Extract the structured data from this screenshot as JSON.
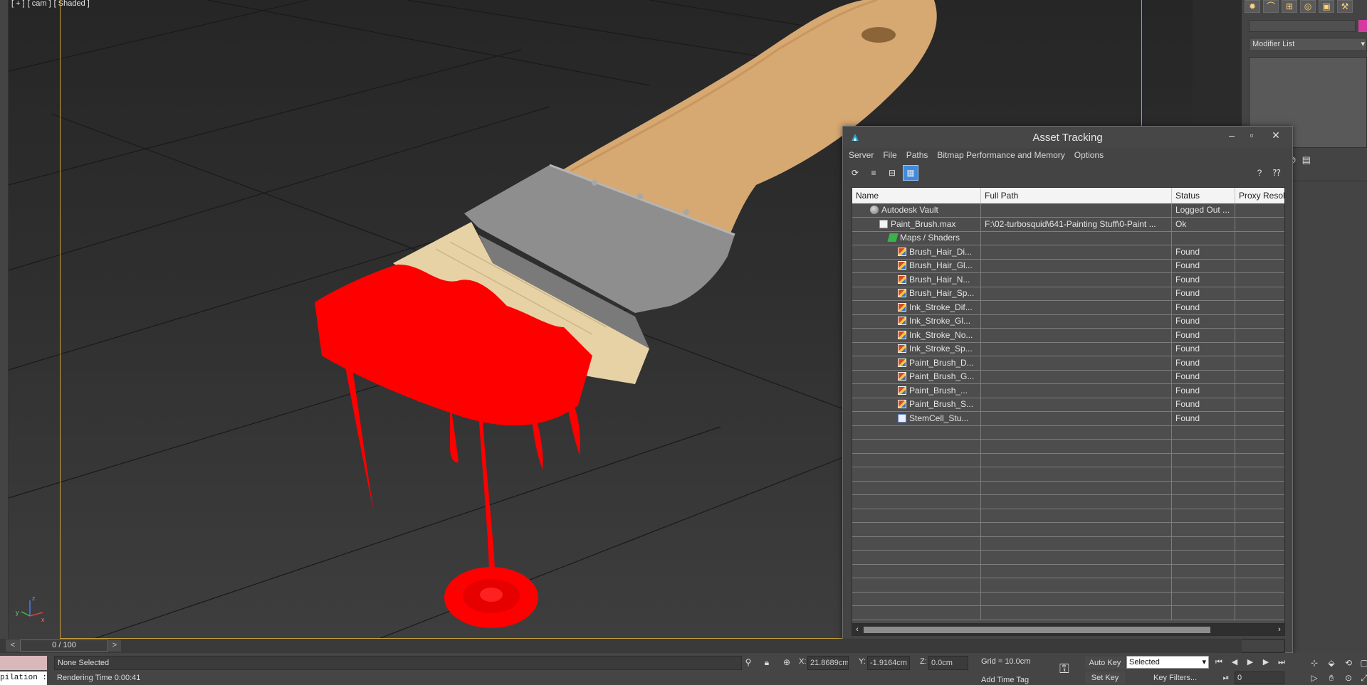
{
  "viewport": {
    "labels": [
      "[ + ]",
      "[ cam ]",
      "[ Shaded ]"
    ],
    "axis_labels": {
      "x": "x",
      "y": "y",
      "z": "z"
    }
  },
  "command_panel": {
    "modifier_list": "Modifier List",
    "tab_icons": [
      "sun-icon",
      "shapes-icon",
      "hierarchy-icon",
      "motion-icon",
      "display-icon",
      "utilities-icon"
    ]
  },
  "dialog": {
    "title": "Asset Tracking",
    "menu": [
      "Server",
      "File",
      "Paths",
      "Bitmap Performance and Memory",
      "Options"
    ],
    "columns": {
      "name": "Name",
      "path": "Full Path",
      "status": "Status",
      "proxy": "Proxy Resol..."
    },
    "rows": [
      {
        "name": "Autodesk Vault",
        "path": "",
        "status": "Logged Out ...",
        "proxy": "",
        "indent": 1,
        "icon": "vault"
      },
      {
        "name": "Paint_Brush.max",
        "path": "F:\\02-turbosquid\\641-Painting Stuff\\0-Paint ...",
        "status": "Ok",
        "proxy": "",
        "indent": 2,
        "icon": "file"
      },
      {
        "name": "Maps / Shaders",
        "path": "",
        "status": "",
        "proxy": "",
        "indent": 3,
        "icon": "maps"
      },
      {
        "name": "Brush_Hair_Di...",
        "path": "",
        "status": "Found",
        "proxy": "",
        "indent": 4,
        "icon": "bitmap"
      },
      {
        "name": "Brush_Hair_Gl...",
        "path": "",
        "status": "Found",
        "proxy": "",
        "indent": 4,
        "icon": "bitmap"
      },
      {
        "name": "Brush_Hair_N...",
        "path": "",
        "status": "Found",
        "proxy": "",
        "indent": 4,
        "icon": "bitmap"
      },
      {
        "name": "Brush_Hair_Sp...",
        "path": "",
        "status": "Found",
        "proxy": "",
        "indent": 4,
        "icon": "bitmap"
      },
      {
        "name": "Ink_Stroke_Dif...",
        "path": "",
        "status": "Found",
        "proxy": "",
        "indent": 4,
        "icon": "bitmap"
      },
      {
        "name": "Ink_Stroke_Gl...",
        "path": "",
        "status": "Found",
        "proxy": "",
        "indent": 4,
        "icon": "bitmap"
      },
      {
        "name": "Ink_Stroke_No...",
        "path": "",
        "status": "Found",
        "proxy": "",
        "indent": 4,
        "icon": "bitmap"
      },
      {
        "name": "Ink_Stroke_Sp...",
        "path": "",
        "status": "Found",
        "proxy": "",
        "indent": 4,
        "icon": "bitmap"
      },
      {
        "name": "Paint_Brush_D...",
        "path": "",
        "status": "Found",
        "proxy": "",
        "indent": 4,
        "icon": "bitmap"
      },
      {
        "name": "Paint_Brush_G...",
        "path": "",
        "status": "Found",
        "proxy": "",
        "indent": 4,
        "icon": "bitmap"
      },
      {
        "name": "Paint_Brush_...",
        "path": "",
        "status": "Found",
        "proxy": "",
        "indent": 4,
        "icon": "bitmap"
      },
      {
        "name": "Paint_Brush_S...",
        "path": "",
        "status": "Found",
        "proxy": "",
        "indent": 4,
        "icon": "bitmap"
      },
      {
        "name": "StemCell_Stu...",
        "path": "",
        "status": "Found",
        "proxy": "",
        "indent": 4,
        "icon": "stem"
      }
    ],
    "empty_rows": 14
  },
  "timeline": {
    "frame_label": "0 / 100",
    "prev": "<",
    "next": ">"
  },
  "status": {
    "selection": "None Selected",
    "prompt": "Rendering Time  0:00:41",
    "listener": "pilation :",
    "x_label": "X:",
    "x_value": "21.8689cm",
    "y_label": "Y:",
    "y_value": "-1.9164cm",
    "z_label": "Z:",
    "z_value": "0.0cm",
    "grid": "Grid = 10.0cm",
    "add_time_tag": "Add Time Tag",
    "auto_key": "Auto Key",
    "set_key": "Set Key",
    "selected_dropdown": "Selected",
    "key_filters": "Key Filters...",
    "frame_field": "0"
  },
  "colors": {
    "paint": "#ff0000",
    "wood": "#d6a872",
    "ferrule": "#8e8e8e",
    "bristles": "#e7d2a6",
    "accent": "#3f8be0"
  }
}
